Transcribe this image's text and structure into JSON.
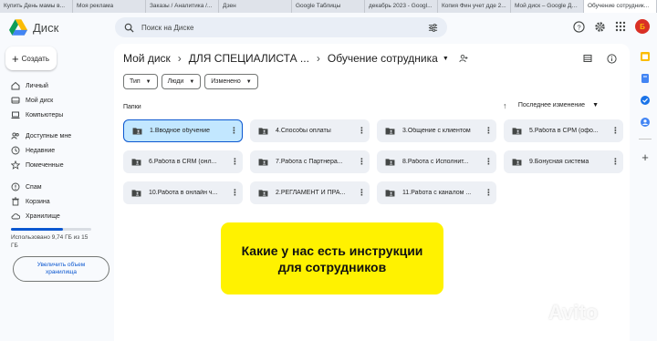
{
  "browser_tabs": [
    {
      "label": "Купить День мамы в..."
    },
    {
      "label": "Моя реклама"
    },
    {
      "label": "Заказы / Аналитика /..."
    },
    {
      "label": "Дзен"
    },
    {
      "label": "Google Таблицы"
    },
    {
      "label": "декабрь 2023 - Googl..."
    },
    {
      "label": "Копия Фин учет дде 2..."
    },
    {
      "label": "Мой диск – Google Ди..."
    },
    {
      "label": "Обучение сотрудник..."
    }
  ],
  "app": {
    "name": "Диск"
  },
  "search": {
    "placeholder": "Поиск на Диске"
  },
  "user": {
    "avatar_letter": "Б"
  },
  "sidebar": {
    "create_label": "Создать",
    "items": [
      {
        "label": "Личный",
        "icon": "home-icon"
      },
      {
        "label": "Мой диск",
        "icon": "drive-icon"
      },
      {
        "label": "Компьютеры",
        "icon": "computer-icon"
      },
      {
        "label": "Доступные мне",
        "icon": "people-icon"
      },
      {
        "label": "Недавние",
        "icon": "clock-icon"
      },
      {
        "label": "Помеченные",
        "icon": "star-icon"
      },
      {
        "label": "Спам",
        "icon": "spam-icon"
      },
      {
        "label": "Корзина",
        "icon": "trash-icon"
      },
      {
        "label": "Хранилище",
        "icon": "cloud-icon"
      }
    ],
    "storage_text": "Использовано 9,74 ГБ из 15 ГБ",
    "storage_fraction": 0.65,
    "upgrade_label": "Увеличить объем хранилища"
  },
  "breadcrumb": {
    "items": [
      "Мой диск",
      "ДЛЯ СПЕЦИАЛИСТА ...",
      "Обучение сотрудника"
    ]
  },
  "filters": {
    "chips": [
      "Тип",
      "Люди",
      "Изменено"
    ]
  },
  "folders_section": {
    "label": "Папки",
    "sort_label": "Последнее изменение",
    "items": [
      {
        "name": "1.Вводное обучение",
        "selected": true
      },
      {
        "name": "4.Способы оплаты"
      },
      {
        "name": "3.Общение с клиентом"
      },
      {
        "name": "5.Работа в СРМ (офо..."
      },
      {
        "name": "6.Работа в CRM (онл..."
      },
      {
        "name": "7.Работа с Партнера..."
      },
      {
        "name": "8.Работа с Исполнит..."
      },
      {
        "name": "9.Бонусная система"
      },
      {
        "name": "10.Работа в онлайн ч..."
      },
      {
        "name": "2.РЕГЛАМЕНТ И ПРА..."
      },
      {
        "name": "11.Работа с каналом ..."
      }
    ]
  },
  "banner": {
    "text": "Какие у нас есть инструкции для сотрудников"
  },
  "watermark": {
    "text": "Avito"
  },
  "colors": {
    "accent": "#0b57d0",
    "selected_folder": "#c2e7ff",
    "banner": "#fff200"
  }
}
